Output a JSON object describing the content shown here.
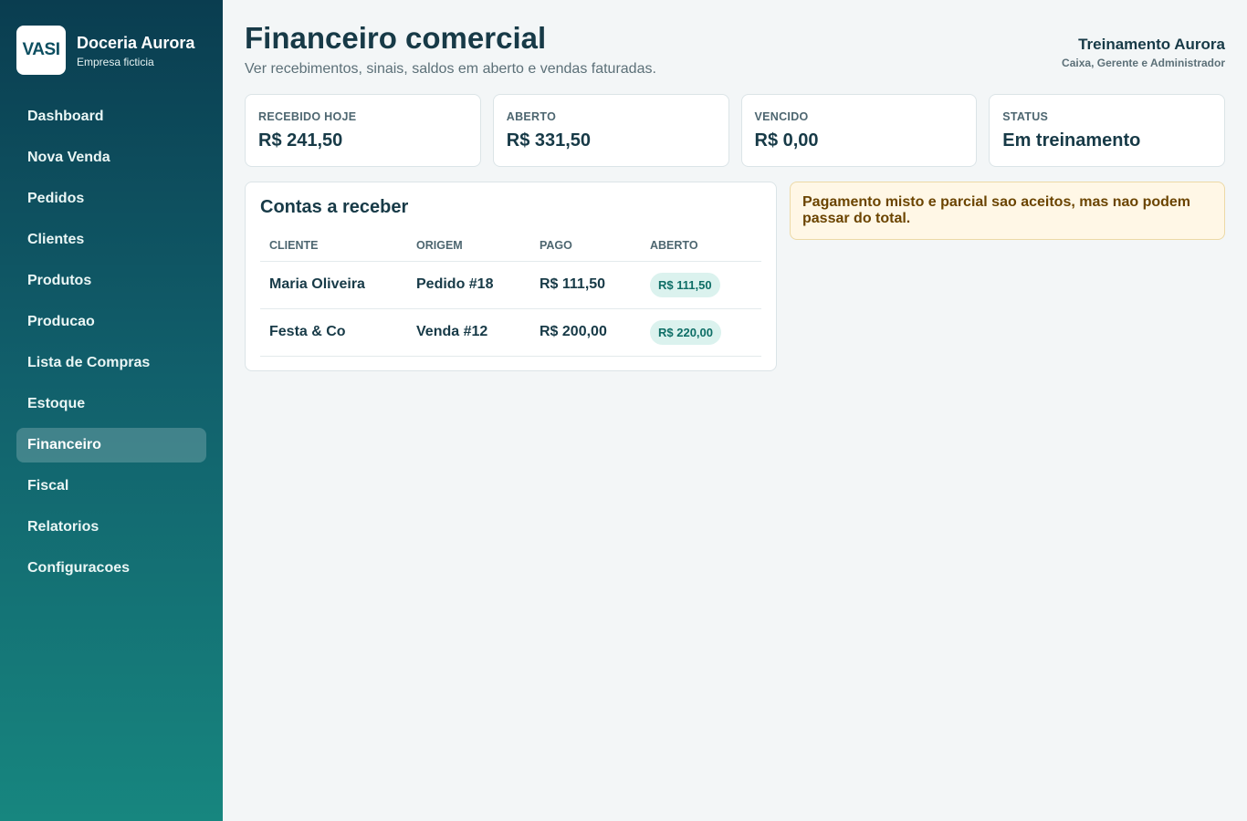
{
  "brand": {
    "logo_text": "VASI",
    "name": "Doceria Aurora",
    "subtitle": "Empresa ficticia"
  },
  "nav": {
    "items": [
      {
        "label": "Dashboard",
        "active": false
      },
      {
        "label": "Nova Venda",
        "active": false
      },
      {
        "label": "Pedidos",
        "active": false
      },
      {
        "label": "Clientes",
        "active": false
      },
      {
        "label": "Produtos",
        "active": false
      },
      {
        "label": "Producao",
        "active": false
      },
      {
        "label": "Lista de Compras",
        "active": false
      },
      {
        "label": "Estoque",
        "active": false
      },
      {
        "label": "Financeiro",
        "active": true
      },
      {
        "label": "Fiscal",
        "active": false
      },
      {
        "label": "Relatorios",
        "active": false
      },
      {
        "label": "Configuracoes",
        "active": false
      }
    ]
  },
  "header": {
    "title": "Financeiro comercial",
    "subtitle": "Ver recebimentos, sinais, saldos em aberto e vendas faturadas."
  },
  "user": {
    "name": "Treinamento Aurora",
    "roles": "Caixa, Gerente e Administrador"
  },
  "kpis": [
    {
      "label": "RECEBIDO HOJE",
      "value": "R$ 241,50"
    },
    {
      "label": "ABERTO",
      "value": "R$ 331,50"
    },
    {
      "label": "VENCIDO",
      "value": "R$ 0,00"
    },
    {
      "label": "STATUS",
      "value": "Em treinamento"
    }
  ],
  "receivables": {
    "title": "Contas a receber",
    "columns": [
      "CLIENTE",
      "ORIGEM",
      "PAGO",
      "ABERTO"
    ],
    "rows": [
      {
        "cliente": "Maria Oliveira",
        "origem": "Pedido #18",
        "pago": "R$ 111,50",
        "aberto": "R$ 111,50"
      },
      {
        "cliente": "Festa & Co",
        "origem": "Venda #12",
        "pago": "R$ 200,00",
        "aberto": "R$ 220,00"
      }
    ]
  },
  "notice": {
    "text": "Pagamento misto e parcial sao aceitos, mas nao podem passar do total."
  },
  "colors": {
    "sidebar_top": "#0a3d50",
    "sidebar_bottom": "#17867f",
    "notice_bg": "#fff7e6",
    "pill_bg": "#dbf2ee"
  }
}
